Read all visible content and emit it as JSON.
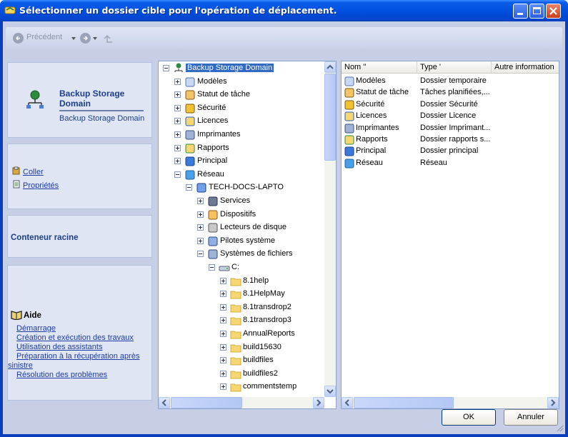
{
  "window": {
    "title": "Sélectionner un dossier cible pour l'opération de déplacement."
  },
  "toolbar": {
    "back_label": "Précédent"
  },
  "sidebar": {
    "server": {
      "name": "Backup Storage Domain",
      "subtitle": "Backup Storage Domain"
    },
    "actions": [
      {
        "label": "Coller"
      },
      {
        "label": "Propriétés"
      }
    ],
    "container_label": "Conteneur racine",
    "help": {
      "title": "Aide",
      "links": [
        "Démarrage",
        "Création et exécution des travaux",
        "Utilisation des assistants",
        "Préparation à la récupération après",
        "sinistre",
        "Résolution des problèmes"
      ]
    }
  },
  "tree": {
    "root": "Backup Storage Domain",
    "items": [
      {
        "label": "Modèles",
        "icon": "templates-icon"
      },
      {
        "label": "Statut de tâche",
        "icon": "job-status-icon"
      },
      {
        "label": "Sécurité",
        "icon": "security-icon"
      },
      {
        "label": "Licences",
        "icon": "licenses-icon"
      },
      {
        "label": "Imprimantes",
        "icon": "printers-icon"
      },
      {
        "label": "Rapports",
        "icon": "reports-icon"
      },
      {
        "label": "Principal",
        "icon": "principal-icon"
      },
      {
        "label": "Réseau",
        "icon": "network-icon"
      },
      {
        "label": "TECH-DOCS-LAPTO",
        "icon": "computer-icon"
      },
      {
        "label": "Services",
        "icon": "services-icon"
      },
      {
        "label": "Dispositifs",
        "icon": "devices-icon"
      },
      {
        "label": "Lecteurs de disque",
        "icon": "disk-drive-icon"
      },
      {
        "label": "Pilotes système",
        "icon": "drivers-icon"
      },
      {
        "label": "Systèmes de fichiers",
        "icon": "filesystems-icon"
      },
      {
        "label": "C:",
        "icon": "drive-c-icon"
      },
      {
        "label": "8.1help",
        "icon": "folder-icon"
      },
      {
        "label": "8.1HelpMay",
        "icon": "folder-icon"
      },
      {
        "label": "8.1transdrop2",
        "icon": "folder-icon"
      },
      {
        "label": "8.1transdrop3",
        "icon": "folder-icon"
      },
      {
        "label": "AnnualReports",
        "icon": "folder-icon"
      },
      {
        "label": "build15630",
        "icon": "folder-icon"
      },
      {
        "label": "buildfiles",
        "icon": "folder-icon"
      },
      {
        "label": "buildfiles2",
        "icon": "folder-icon"
      },
      {
        "label": "commentstemp",
        "icon": "folder-icon"
      }
    ]
  },
  "list": {
    "columns": [
      "Nom ''",
      "Type '",
      "Autre information"
    ],
    "rows": [
      {
        "name": "Modèles",
        "type": "Dossier temporaire"
      },
      {
        "name": "Statut de tâche",
        "type": "Tâches planifiées,..."
      },
      {
        "name": "Sécurité",
        "type": "Dossier Sécurité"
      },
      {
        "name": "Licences",
        "type": "Dossier Licence"
      },
      {
        "name": "Imprimantes",
        "type": "Dossier Imprimant..."
      },
      {
        "name": "Rapports",
        "type": "Dossier rapports s..."
      },
      {
        "name": "Principal",
        "type": "Dossier principal"
      },
      {
        "name": "Réseau",
        "type": "Réseau"
      }
    ]
  },
  "buttons": {
    "ok": "OK",
    "cancel": "Annuler"
  }
}
